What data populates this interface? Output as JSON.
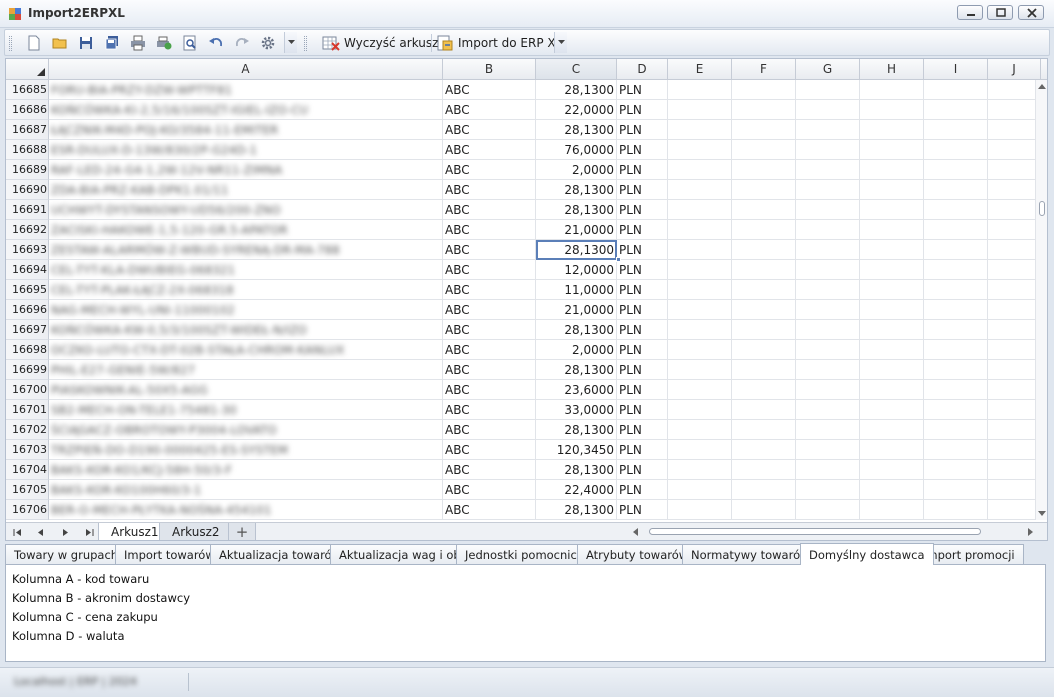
{
  "window": {
    "title": "Import2ERPXL"
  },
  "toolbar": {
    "clear_label": "Wyczyść arkusz",
    "import_label": "Import do ERP XL"
  },
  "sheet": {
    "columns": [
      "A",
      "B",
      "C",
      "D",
      "E",
      "F",
      "G",
      "H",
      "I",
      "J"
    ],
    "selected_column": "C",
    "active_cell": "C16693",
    "rows": [
      {
        "num": "16685",
        "a": "FORU-BIA-PRZY-DZW-WPTTF81",
        "b": "ABC",
        "c": "28,1300",
        "d": "PLN"
      },
      {
        "num": "16686",
        "a": "KOŃCÓWKA-KI-2,5/16/100SZT-IGIEL-IZO-CU",
        "b": "ABC",
        "c": "22,0000",
        "d": "PLN"
      },
      {
        "num": "16687",
        "a": "ŁĄCZNIK-M4D-POJ-KO/3584-11-EMITER",
        "b": "ABC",
        "c": "28,1300",
        "d": "PLN"
      },
      {
        "num": "16688",
        "a": "ESR-DULUX-D-13W/830/2P-G24D-1",
        "b": "ABC",
        "c": "76,0000",
        "d": "PLN"
      },
      {
        "num": "16689",
        "a": "RAF-LED-24-G4-1,2W-12V-NR11-ZIMNA",
        "b": "ABC",
        "c": "2,0000",
        "d": "PLN"
      },
      {
        "num": "16690",
        "a": "ZDA-BIA-PRZ-KAB-DPK1.01/11",
        "b": "ABC",
        "c": "28,1300",
        "d": "PLN"
      },
      {
        "num": "16691",
        "a": "UCHWYT-DYSTANSOWY-UD56/200-ZNO",
        "b": "ABC",
        "c": "28,1300",
        "d": "PLN"
      },
      {
        "num": "16692",
        "a": "ZACISKI-HAKOWE-1,5-120-GR.5-APATOR",
        "b": "ABC",
        "c": "21,0000",
        "d": "PLN"
      },
      {
        "num": "16693",
        "a": "ZESTAW-ALARMÓW-Z-WBUD-SYRENĄ-DR-MA-788",
        "b": "ABC",
        "c": "28,1300",
        "d": "PLN"
      },
      {
        "num": "16694",
        "a": "CEL-TYT-KLA-DWUBIEG-068321",
        "b": "ABC",
        "c": "12,0000",
        "d": "PLN"
      },
      {
        "num": "16695",
        "a": "CEL-TYT-PLAK-ŁĄCZ-2X-068318",
        "b": "ABC",
        "c": "11,0000",
        "d": "PLN"
      },
      {
        "num": "16696",
        "a": "NAG-MECH-WYL-UNI-11000102",
        "b": "ABC",
        "c": "21,0000",
        "d": "PLN"
      },
      {
        "num": "16697",
        "a": "KOŃCÓWKA-KW-0,5/3/100SZT-WIDEŁ-N/IZO",
        "b": "ABC",
        "c": "28,1300",
        "d": "PLN"
      },
      {
        "num": "16698",
        "a": "OCZKO-LUTO-CTX-DT-02B-STAŁA-CHROM-KANLUX",
        "b": "ABC",
        "c": "2,0000",
        "d": "PLN"
      },
      {
        "num": "16699",
        "a": "PHIL-E27-GENIE-5W/827",
        "b": "ABC",
        "c": "28,1300",
        "d": "PLN"
      },
      {
        "num": "16700",
        "a": "PIASKOWNIK-AL-50X5-AGG",
        "b": "ABC",
        "c": "23,6000",
        "d": "PLN"
      },
      {
        "num": "16701",
        "a": "SB2-MECH-ON-TELE1-75481-30",
        "b": "ABC",
        "c": "33,0000",
        "d": "PLN"
      },
      {
        "num": "16702",
        "a": "ŚCIĄGACZ-OBROTOWY-P3004-LOVATO",
        "b": "ABC",
        "c": "28,1300",
        "d": "PLN"
      },
      {
        "num": "16703",
        "a": "TRZPIEŃ-DO-D190-0000425-ES-SYSTEM",
        "b": "ABC",
        "c": "120,3450",
        "d": "PLN"
      },
      {
        "num": "16704",
        "a": "BAKS-KOR-KO1/KCJ-58H-50/3-F",
        "b": "ABC",
        "c": "28,1300",
        "d": "PLN"
      },
      {
        "num": "16705",
        "a": "BAKS-KOR-KO100H60/3-1",
        "b": "ABC",
        "c": "22,4000",
        "d": "PLN"
      },
      {
        "num": "16706",
        "a": "BER-O-MECH-PŁYTKA-NOŚNA-454101",
        "b": "ABC",
        "c": "28,1300",
        "d": "PLN"
      }
    ],
    "sheet_tabs": [
      "Arkusz1",
      "Arkusz2"
    ],
    "active_sheet": "Arkusz1",
    "add_sheet_label": "+"
  },
  "tabs": [
    "Towary w grupach",
    "Import towarów",
    "Aktualizacja towarów",
    "Aktualizacja wag i obj.",
    "Jednostki pomocnicze",
    "Atrybuty towarów",
    "Normatywy towarów",
    "Domyślny dostawca",
    "Import promocji"
  ],
  "active_tab": "Domyślny dostawca",
  "panel": {
    "lines": [
      "Kolumna A - kod towaru",
      "Kolumna B - akronim dostawcy",
      "Kolumna C - cena zakupu",
      "Kolumna D - waluta"
    ]
  },
  "status": {
    "text": "Localhost | ERP | 2024"
  }
}
